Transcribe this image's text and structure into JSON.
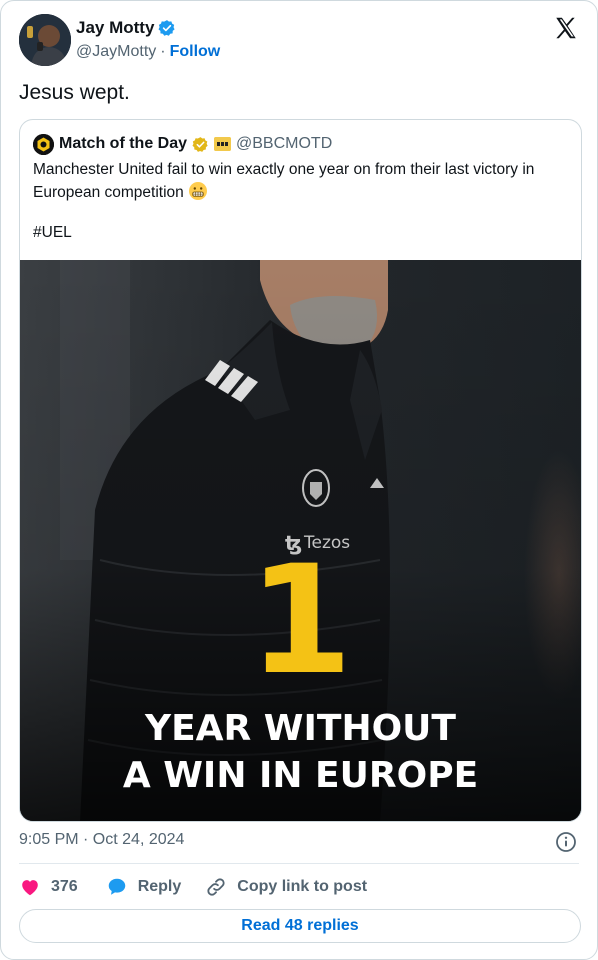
{
  "author": {
    "name": "Jay Motty",
    "handle": "@JayMotty",
    "separator": "·",
    "follow_label": "Follow"
  },
  "tweet": {
    "text": "Jesus wept."
  },
  "quoted": {
    "name": "Match of the Day",
    "handle": "@BBCMOTD",
    "text": "Manchester United fail to win exactly one year on from their last victory in European competition",
    "emoji": "grimacing-face",
    "hashtag": "#UEL",
    "media": {
      "sponsor": "Tezos",
      "big_number": "1",
      "caption_line1": "YEAR WITHOUT",
      "caption_line2": "A WIN IN EUROPE"
    }
  },
  "meta": {
    "timestamp": "9:05 PM · Oct 24, 2024"
  },
  "actions": {
    "likes": "376",
    "reply_label": "Reply",
    "copy_label": "Copy link to post",
    "read_replies_label": "Read 48 replies"
  },
  "colors": {
    "link_blue": "#006fd6",
    "verified_blue": "#1d9bf0",
    "like_pink": "#f91880",
    "gold": "#f4c215"
  },
  "icons": [
    "verified-badge-icon",
    "x-logo-icon",
    "gold-badge-icon",
    "info-icon",
    "heart-icon",
    "reply-bubble-icon",
    "link-icon"
  ]
}
